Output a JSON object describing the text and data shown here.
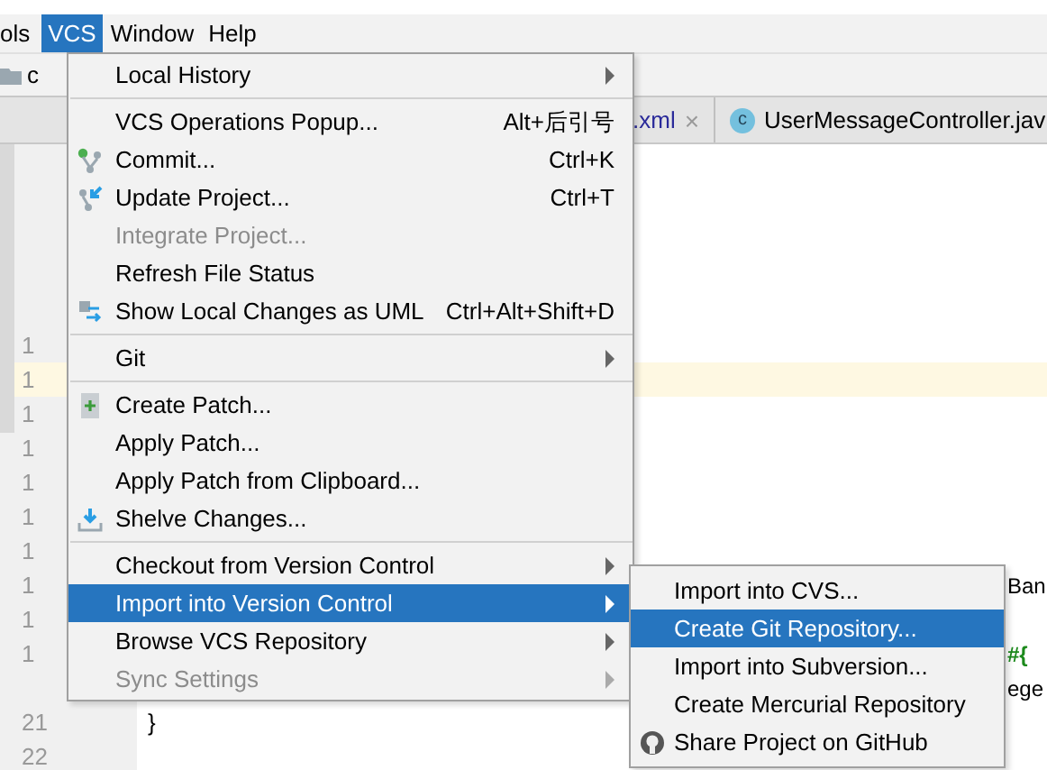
{
  "menubar": [
    {
      "label": "ols",
      "selected": false
    },
    {
      "label": "VCS",
      "selected": true
    },
    {
      "label": "Window",
      "selected": false
    },
    {
      "label": "Help",
      "selected": false
    }
  ],
  "breadcrumb": "c",
  "tabs": [
    {
      "label": ".xml",
      "selected": false,
      "close": "×"
    },
    {
      "label": "UserMessageController.jav",
      "selected": false,
      "icon_letter": "c"
    }
  ],
  "gutter": [
    {
      "number": "1",
      "caret": false
    },
    {
      "number": "1",
      "caret": true
    },
    {
      "number": "1",
      "caret": false
    },
    {
      "number": "1",
      "caret": false
    },
    {
      "number": "1",
      "caret": false
    },
    {
      "number": "1",
      "caret": false
    },
    {
      "number": "1",
      "caret": false
    },
    {
      "number": "1",
      "caret": false,
      "code_tail": "Ban"
    },
    {
      "number": "1",
      "caret": false
    },
    {
      "number": "1",
      "caret": false,
      "code_tail": "#{"
    },
    {
      "caret": false,
      "code_tail": "ege"
    },
    {
      "number": "21",
      "caret": false,
      "code": "}"
    },
    {
      "number": "22",
      "caret": false
    }
  ],
  "vcs_menu": [
    {
      "kind": "item",
      "label": "Local History",
      "submenu": true,
      "disabled": false,
      "selected": false
    },
    {
      "kind": "separator"
    },
    {
      "kind": "item",
      "label": "VCS Operations Popup...",
      "shortcut": "Alt+后引号",
      "submenu": false,
      "disabled": false,
      "selected": false
    },
    {
      "kind": "item",
      "label": "Commit...",
      "shortcut": "Ctrl+K",
      "submenu": false,
      "disabled": false,
      "selected": false
    },
    {
      "kind": "item",
      "label": "Update Project...",
      "shortcut": "Ctrl+T",
      "submenu": false,
      "disabled": false,
      "selected": false
    },
    {
      "kind": "item",
      "label": "Integrate Project...",
      "submenu": false,
      "disabled": true,
      "selected": false
    },
    {
      "kind": "item",
      "label": "Refresh File Status",
      "submenu": false,
      "disabled": false,
      "selected": false
    },
    {
      "kind": "item",
      "label": "Show Local Changes as UML",
      "shortcut": "Ctrl+Alt+Shift+D",
      "submenu": false,
      "disabled": false,
      "selected": false
    },
    {
      "kind": "separator"
    },
    {
      "kind": "item",
      "label": "Git",
      "submenu": true,
      "disabled": false,
      "selected": false
    },
    {
      "kind": "separator"
    },
    {
      "kind": "item",
      "label": "Create Patch...",
      "submenu": false,
      "disabled": false,
      "selected": false
    },
    {
      "kind": "item",
      "label": "Apply Patch...",
      "submenu": false,
      "disabled": false,
      "selected": false
    },
    {
      "kind": "item",
      "label": "Apply Patch from Clipboard...",
      "submenu": false,
      "disabled": false,
      "selected": false
    },
    {
      "kind": "item",
      "label": "Shelve Changes...",
      "submenu": false,
      "disabled": false,
      "selected": false
    },
    {
      "kind": "separator"
    },
    {
      "kind": "item",
      "label": "Checkout from Version Control",
      "submenu": true,
      "disabled": false,
      "selected": false
    },
    {
      "kind": "item",
      "label": "Import into Version Control",
      "submenu": true,
      "disabled": false,
      "selected": true
    },
    {
      "kind": "item",
      "label": "Browse VCS Repository",
      "submenu": true,
      "disabled": false,
      "selected": false
    },
    {
      "kind": "item",
      "label": "Sync Settings",
      "submenu": true,
      "disabled": true,
      "selected": false
    }
  ],
  "import_submenu": [
    {
      "label": "Import into CVS...",
      "selected": false
    },
    {
      "label": "Create Git Repository...",
      "selected": true
    },
    {
      "label": "Import into Subversion...",
      "selected": false
    },
    {
      "label": "Create Mercurial Repository",
      "selected": false
    },
    {
      "label": "Share Project on GitHub",
      "selected": false
    }
  ]
}
